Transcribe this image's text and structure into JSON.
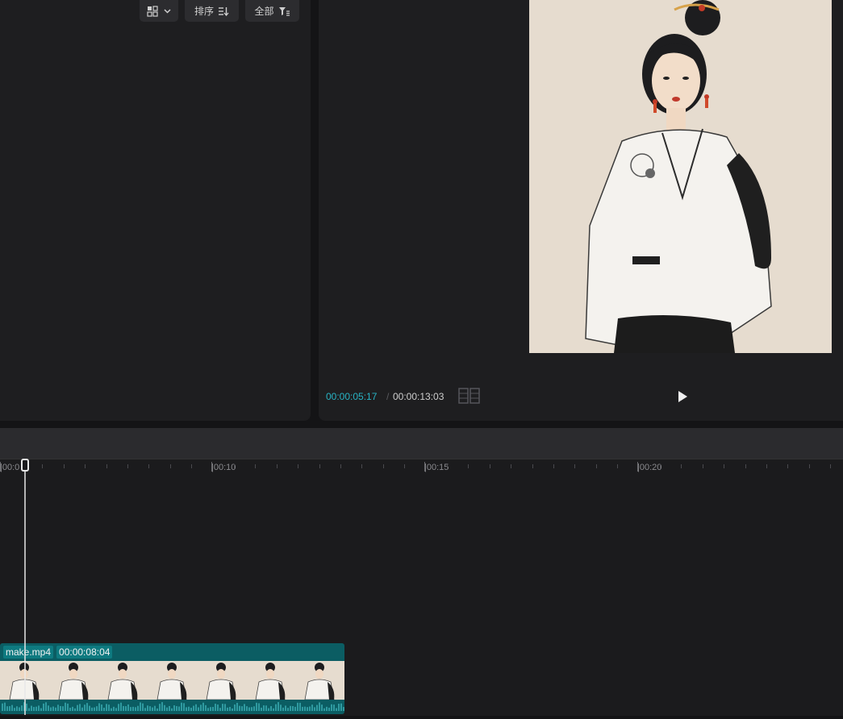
{
  "media_toolbar": {
    "view_icon": "grid-view-icon",
    "sort_label": "排序",
    "sort_icon": "sort-icon",
    "filter_label": "全部",
    "filter_icon": "filter-icon"
  },
  "player": {
    "current_time": "00:00:05:17",
    "separator": "/",
    "total_time": "00:00:13:03",
    "ratio_icon": "aspect-ratio-icon",
    "play_icon": "play-icon"
  },
  "timeline": {
    "ruler_labels": [
      "|00:0",
      "|00:10",
      "|00:15",
      "|00:20"
    ]
  },
  "clip": {
    "name": "make.mp4",
    "duration": "00:00:08:04"
  },
  "colors": {
    "accent_time": "#28b3c4",
    "clip": "#0b5d63"
  }
}
